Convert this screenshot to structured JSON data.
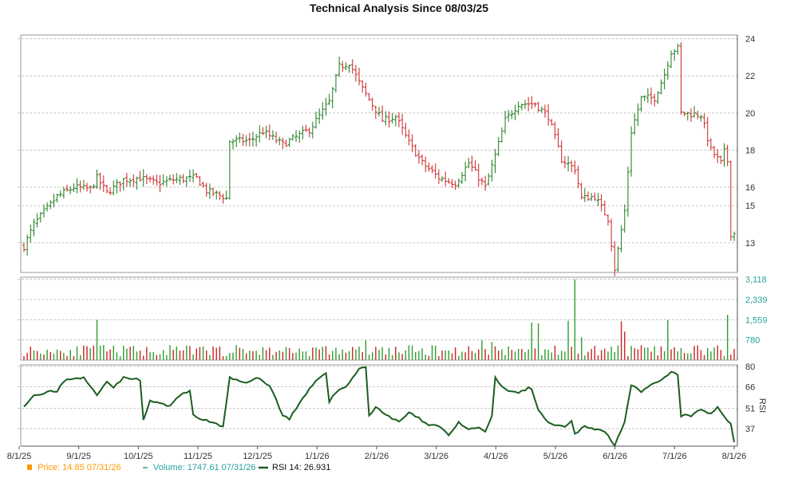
{
  "chart_data": {
    "title": "Technical Analysis Since 08/03/25",
    "x_tick_labels": [
      "8/1/25",
      "9/1/25",
      "10/1/25",
      "11/1/25",
      "12/1/25",
      "1/1/26",
      "2/1/26",
      "3/1/26",
      "4/1/26",
      "5/1/26",
      "6/1/26",
      "7/1/26",
      "8/1/26"
    ],
    "panels": [
      {
        "name": "price",
        "type": "ohlc",
        "y_ticks": [
          "24",
          "22",
          "20",
          "18",
          "16",
          "15",
          "13"
        ],
        "ylim": [
          11.4,
          24.2
        ],
        "grid": true,
        "anchors": [
          [
            0,
            12.8
          ],
          [
            3,
            14.0
          ],
          [
            10,
            15.5
          ],
          [
            15,
            16.0
          ],
          [
            20,
            15.9
          ],
          [
            22,
            16.5
          ],
          [
            25,
            15.7
          ],
          [
            30,
            16.4
          ],
          [
            35,
            16.5
          ],
          [
            40,
            16.2
          ],
          [
            45,
            16.4
          ],
          [
            52,
            16.5
          ],
          [
            55,
            15.8
          ],
          [
            60,
            15.5
          ],
          [
            61,
            15.4
          ],
          [
            62,
            18.5
          ],
          [
            68,
            18.5
          ],
          [
            72,
            19.0
          ],
          [
            78,
            18.3
          ],
          [
            83,
            18.8
          ],
          [
            86,
            19.1
          ],
          [
            92,
            20.6
          ],
          [
            95,
            22.5
          ],
          [
            98,
            22.7
          ],
          [
            102,
            21.3
          ],
          [
            108,
            19.6
          ],
          [
            112,
            19.8
          ],
          [
            116,
            18.4
          ],
          [
            120,
            17.3
          ],
          [
            125,
            16.5
          ],
          [
            130,
            16.2
          ],
          [
            134,
            17.3
          ],
          [
            139,
            16.0
          ],
          [
            142,
            17.7
          ],
          [
            145,
            19.6
          ],
          [
            149,
            20.5
          ],
          [
            154,
            20.5
          ],
          [
            158,
            19.8
          ],
          [
            162,
            17.5
          ],
          [
            166,
            17.0
          ],
          [
            168,
            15.4
          ],
          [
            172,
            15.5
          ],
          [
            176,
            14.3
          ],
          [
            178,
            11.6
          ],
          [
            181,
            14.7
          ],
          [
            183,
            19.0
          ],
          [
            186,
            20.8
          ],
          [
            190,
            20.8
          ],
          [
            193,
            22.1
          ],
          [
            195,
            23.3
          ],
          [
            197,
            23.5
          ],
          [
            198,
            20.0
          ],
          [
            204,
            19.9
          ],
          [
            207,
            18.0
          ],
          [
            210,
            17.3
          ],
          [
            211,
            17.9
          ],
          [
            212,
            17.4
          ],
          [
            213,
            13.5
          ]
        ],
        "last_point": {
          "date": "07/31/26",
          "price": 14.85
        }
      },
      {
        "name": "volume",
        "type": "bar",
        "y_ticks": [
          "3,118",
          "2,339",
          "1,559",
          "780"
        ],
        "ylim": [
          0,
          3200
        ],
        "grid": true,
        "spikes": [
          [
            22,
            1559
          ],
          [
            103,
            760
          ],
          [
            138,
            770
          ],
          [
            141,
            700
          ],
          [
            142,
            530
          ],
          [
            153,
            1450
          ],
          [
            155,
            1420
          ],
          [
            164,
            1520
          ],
          [
            166,
            3118
          ],
          [
            168,
            880
          ],
          [
            180,
            1500
          ],
          [
            181,
            1100
          ],
          [
            194,
            1550
          ],
          [
            212,
            1747.61
          ]
        ],
        "last_point": {
          "date": "07/31/26",
          "volume": 1747.61
        }
      },
      {
        "name": "rsi",
        "type": "line",
        "y_ticks": [
          "80",
          "66",
          "51",
          "37"
        ],
        "y_axis_label": "RSI",
        "ylim": [
          25,
          81
        ],
        "grid": true,
        "anchors": [
          [
            0,
            53
          ],
          [
            3,
            60
          ],
          [
            8,
            63
          ],
          [
            10,
            62
          ],
          [
            12,
            70
          ],
          [
            15,
            72
          ],
          [
            18,
            72
          ],
          [
            20,
            66
          ],
          [
            22,
            60
          ],
          [
            25,
            70
          ],
          [
            27,
            66
          ],
          [
            30,
            72
          ],
          [
            33,
            72
          ],
          [
            35,
            70
          ],
          [
            36,
            43
          ],
          [
            38,
            56
          ],
          [
            42,
            54
          ],
          [
            44,
            52
          ],
          [
            46,
            58
          ],
          [
            48,
            62
          ],
          [
            50,
            63
          ],
          [
            51,
            46
          ],
          [
            53,
            44
          ],
          [
            56,
            42
          ],
          [
            58,
            40
          ],
          [
            60,
            38
          ],
          [
            62,
            72
          ],
          [
            65,
            70
          ],
          [
            68,
            69
          ],
          [
            70,
            72
          ],
          [
            72,
            70
          ],
          [
            74,
            67
          ],
          [
            76,
            57
          ],
          [
            78,
            46
          ],
          [
            80,
            44
          ],
          [
            83,
            54
          ],
          [
            86,
            64
          ],
          [
            89,
            72
          ],
          [
            91,
            76
          ],
          [
            92,
            56
          ],
          [
            93,
            59
          ],
          [
            95,
            64
          ],
          [
            97,
            66
          ],
          [
            99,
            72
          ],
          [
            101,
            78
          ],
          [
            103,
            80
          ],
          [
            104,
            46
          ],
          [
            106,
            52
          ],
          [
            110,
            45
          ],
          [
            113,
            42
          ],
          [
            116,
            48
          ],
          [
            119,
            44
          ],
          [
            122,
            40
          ],
          [
            125,
            39
          ],
          [
            128,
            33
          ],
          [
            131,
            41
          ],
          [
            134,
            36
          ],
          [
            137,
            38
          ],
          [
            139,
            35
          ],
          [
            141,
            45
          ],
          [
            142,
            72
          ],
          [
            144,
            66
          ],
          [
            147,
            62
          ],
          [
            149,
            62
          ],
          [
            152,
            65
          ],
          [
            153,
            64
          ],
          [
            155,
            50
          ],
          [
            157,
            43
          ],
          [
            160,
            39
          ],
          [
            163,
            38
          ],
          [
            165,
            42
          ],
          [
            166,
            33
          ],
          [
            169,
            39
          ],
          [
            172,
            37
          ],
          [
            175,
            35
          ],
          [
            178,
            26
          ],
          [
            181,
            42
          ],
          [
            183,
            67
          ],
          [
            186,
            62
          ],
          [
            189,
            67
          ],
          [
            192,
            70
          ],
          [
            195,
            76
          ],
          [
            197,
            74
          ],
          [
            198,
            46
          ],
          [
            201,
            46
          ],
          [
            204,
            50
          ],
          [
            207,
            47
          ],
          [
            209,
            52
          ],
          [
            211,
            46
          ],
          [
            213,
            40
          ],
          [
            214,
            26.931
          ]
        ],
        "last_point": {
          "rsi_period": "14",
          "value": 26.931
        }
      }
    ],
    "legend": [
      {
        "label": "Price: 14.85",
        "date": "07/31/26",
        "color": "#ff9900",
        "marker": "square"
      },
      {
        "label": "Volume: 1747.61",
        "date": "07/31/26",
        "color": "#26a2a2",
        "marker": "dash"
      },
      {
        "label": "RSI 14: 26.931",
        "color": "#1b5e20",
        "marker": "line"
      }
    ],
    "colors": {
      "up": "#1a7a1a",
      "down": "#cc2222",
      "rsi": "#1b5e20",
      "volume_axis": "#26a2a2",
      "grid": "#c8c8c8"
    }
  }
}
